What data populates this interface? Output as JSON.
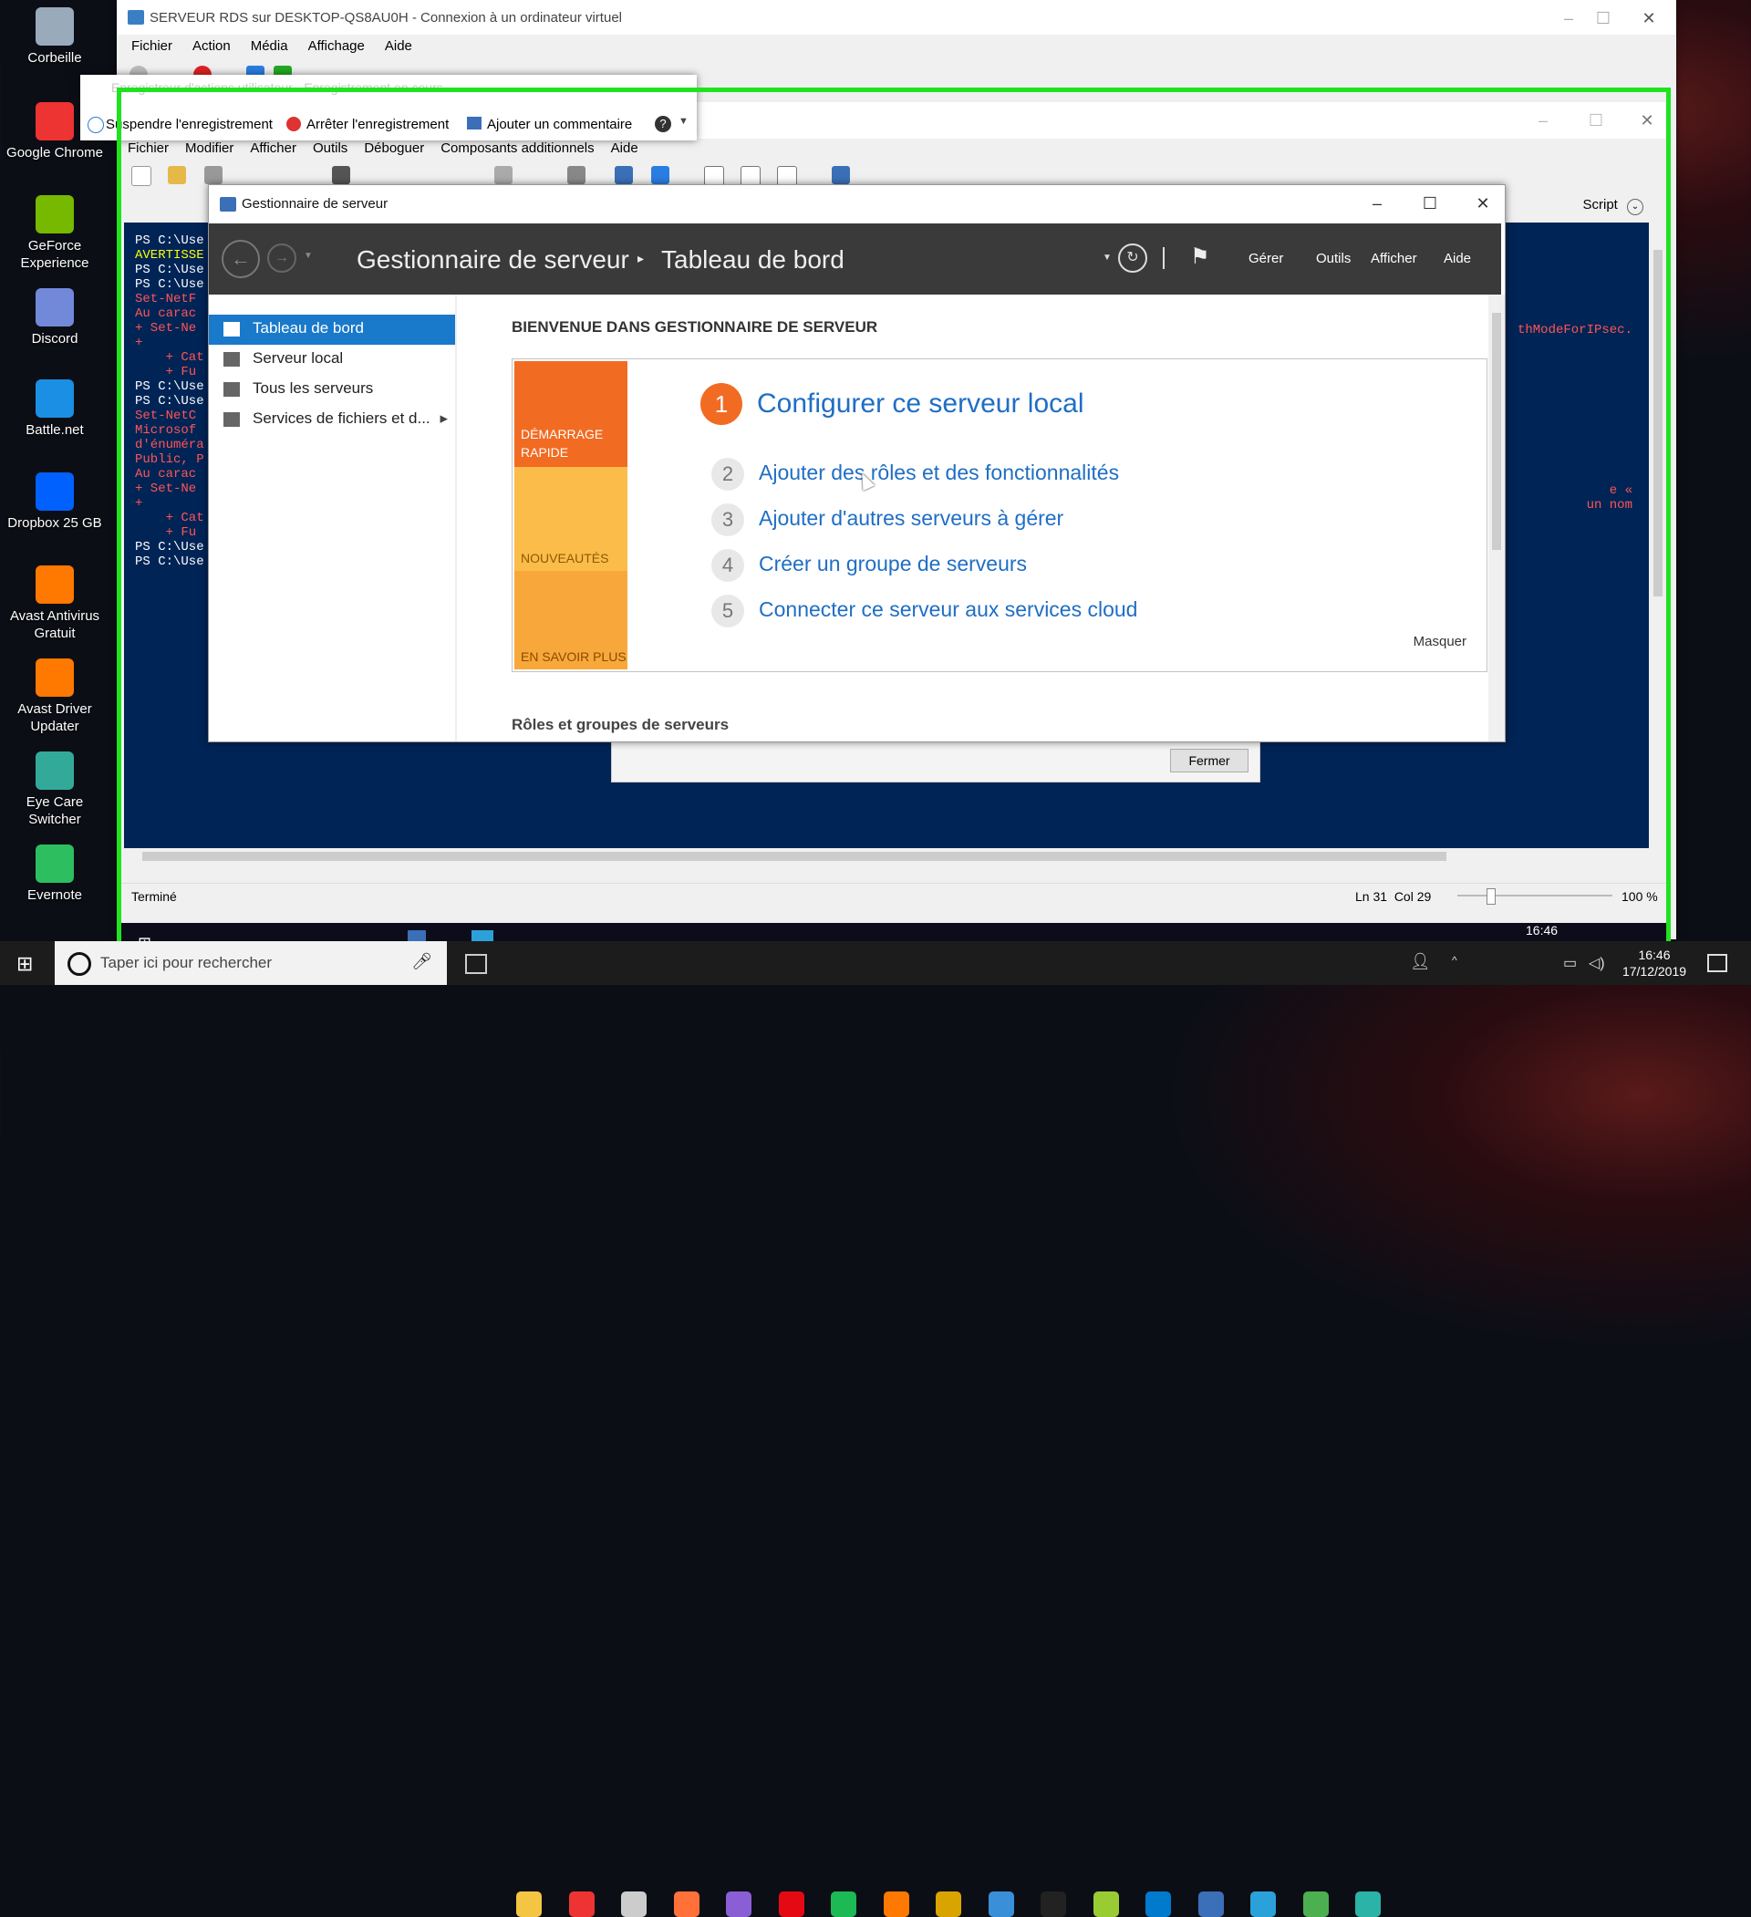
{
  "desktop_icons": [
    {
      "label": "Corbeille",
      "icon": "recycle-bin-icon",
      "color": "#9ab"
    },
    {
      "label": "Google Chrome",
      "icon": "chrome-icon",
      "color": "#e33"
    },
    {
      "label": "GeForce Experience",
      "icon": "geforce-icon",
      "color": "#76b900"
    },
    {
      "label": "Discord",
      "icon": "discord-icon",
      "color": "#7289da"
    },
    {
      "label": "Battle.net",
      "icon": "battlenet-icon",
      "color": "#1a8fe3"
    },
    {
      "label": "Dropbox 25 GB",
      "icon": "dropbox-icon",
      "color": "#0061ff"
    },
    {
      "label": "Avast Antivirus Gratuit",
      "icon": "avast-icon",
      "color": "#ff7800"
    },
    {
      "label": "Avast Driver Updater",
      "icon": "avast-driver-icon",
      "color": "#ff7800"
    },
    {
      "label": "Eye Care Switcher",
      "icon": "eye-care-icon",
      "color": "#3a9"
    },
    {
      "label": "Evernote",
      "icon": "evernote-icon",
      "color": "#2dbe60"
    }
  ],
  "vm_window": {
    "title": "SERVEUR RDS sur DESKTOP-QS8AU0H - Connexion à un ordinateur virtuel",
    "menu": [
      "Fichier",
      "Action",
      "Média",
      "Affichage",
      "Aide"
    ]
  },
  "recorder": {
    "title": "Enregistreur d'actions utilisateur - Enregistrement en cours",
    "buttons": [
      "Suspendre l'enregistrement",
      "Arrêter l'enregistrement",
      "Ajouter un commentaire"
    ]
  },
  "ise_window": {
    "menu": [
      "Fichier",
      "Modifier",
      "Afficher",
      "Outils",
      "Déboguer",
      "Composants additionnels",
      "Aide"
    ],
    "script_label": "Script",
    "status": "Terminé",
    "position": "Ln 31  Col 29",
    "zoom": "100 %",
    "console_lines": [
      {
        "t": "PS C:\\Use",
        "c": "#fff"
      },
      {
        "t": "AVERTISSE",
        "c": "#ff0"
      },
      {
        "t": "",
        "c": "#fff"
      },
      {
        "t": "PS C:\\Use",
        "c": "#fff"
      },
      {
        "t": "",
        "c": "#fff"
      },
      {
        "t": "PS C:\\Use",
        "c": "#fff"
      },
      {
        "t": "Set-NetF",
        "c": "#f55"
      },
      {
        "t": "Au carac",
        "c": "#f55"
      },
      {
        "t": "+ Set-Ne",
        "c": "#f55"
      },
      {
        "t": "+",
        "c": "#f55"
      },
      {
        "t": "    + Cat",
        "c": "#f55"
      },
      {
        "t": "    + Fu",
        "c": "#f55"
      },
      {
        "t": "",
        "c": "#fff"
      },
      {
        "t": "PS C:\\Use",
        "c": "#fff"
      },
      {
        "t": "",
        "c": "#fff"
      },
      {
        "t": "PS C:\\Use",
        "c": "#fff"
      },
      {
        "t": "Set-NetC",
        "c": "#f55"
      },
      {
        "t": "Microsof",
        "c": "#f55"
      },
      {
        "t": "d'énuméra",
        "c": "#f55"
      },
      {
        "t": "Public, P",
        "c": "#f55"
      },
      {
        "t": "Au carac",
        "c": "#f55"
      },
      {
        "t": "+ Set-Ne",
        "c": "#f55"
      },
      {
        "t": "+",
        "c": "#f55"
      },
      {
        "t": "    + Cat",
        "c": "#f55"
      },
      {
        "t": "    + Fu",
        "c": "#f55"
      },
      {
        "t": "",
        "c": "#fff"
      },
      {
        "t": "PS C:\\Use",
        "c": "#fff"
      },
      {
        "t": "",
        "c": "#fff"
      },
      {
        "t": "PS C:\\Use",
        "c": "#fff"
      }
    ],
    "console_right": [
      {
        "t": "thModeForIPsec.",
        "c": "#f55"
      },
      {
        "t": "e «",
        "c": "#f55"
      },
      {
        "t": "un nom",
        "c": "#f55"
      }
    ],
    "dialog_close": "Fermer"
  },
  "server_manager": {
    "window_title": "Gestionnaire de serveur",
    "breadcrumb_root": "Gestionnaire de serveur",
    "breadcrumb_current": "Tableau de bord",
    "nav_menu": [
      "Gérer",
      "Outils",
      "Afficher",
      "Aide"
    ],
    "sidebar": [
      {
        "label": "Tableau de bord",
        "active": true
      },
      {
        "label": "Serveur local",
        "active": false
      },
      {
        "label": "Tous les serveurs",
        "active": false
      },
      {
        "label": "Services de fichiers et d...",
        "active": false
      }
    ],
    "welcome_title": "BIENVENUE DANS GESTIONNAIRE DE SERVEUR",
    "tiles": [
      "DÉMARRAGE RAPIDE",
      "NOUVEAUTÉS",
      "EN SAVOIR PLUS"
    ],
    "steps": [
      {
        "num": "1",
        "label": "Configurer ce serveur local"
      },
      {
        "num": "2",
        "label": "Ajouter des rôles et des fonctionnalités"
      },
      {
        "num": "3",
        "label": "Ajouter d'autres serveurs à gérer"
      },
      {
        "num": "4",
        "label": "Créer un groupe de serveurs"
      },
      {
        "num": "5",
        "label": "Connecter ce serveur aux services cloud"
      }
    ],
    "hide_link": "Masquer",
    "roles_heading": "Rôles et groupes de serveurs"
  },
  "taskbar": {
    "search_placeholder": "Taper ici pour rechercher",
    "time": "16:46",
    "date": "17/12/2019",
    "inner_time": "16:46"
  }
}
